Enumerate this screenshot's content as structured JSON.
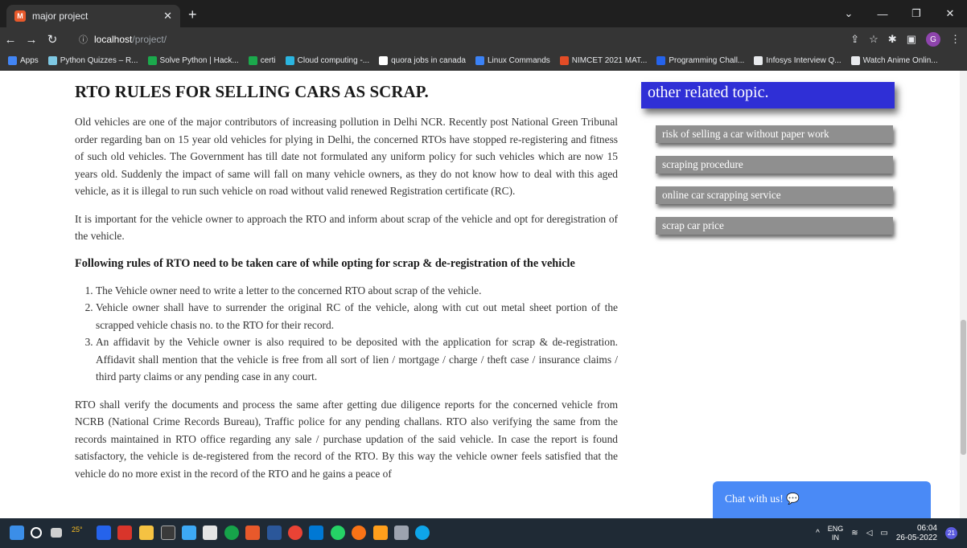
{
  "browser": {
    "tab_title": "major project",
    "tab_favicon": "M",
    "url_host": "localhost",
    "url_path": "/project/",
    "profile_initial": "G",
    "bookmarks": [
      {
        "label": "Apps",
        "color": "#4285f4"
      },
      {
        "label": "Python Quizzes – R...",
        "color": "#7ec8e3"
      },
      {
        "label": "Solve Python | Hack...",
        "color": "#1ba94c"
      },
      {
        "label": "certi",
        "color": "#1ba94c"
      },
      {
        "label": "Cloud computing -...",
        "color": "#2bb5e0"
      },
      {
        "label": "quora jobs in canada",
        "color": "#ffffff"
      },
      {
        "label": "Linux Commands",
        "color": "#3b82f6"
      },
      {
        "label": "NIMCET 2021 MAT...",
        "color": "#e34c26"
      },
      {
        "label": "Programming Chall...",
        "color": "#2563eb"
      },
      {
        "label": "Infosys Interview Q...",
        "color": "#e8eaed"
      },
      {
        "label": "Watch Anime Onlin...",
        "color": "#e8eaed"
      }
    ]
  },
  "article": {
    "title": "RTO RULES FOR SELLING CARS AS SCRAP.",
    "para1": "Old vehicles are one of the major contributors of increasing pollution in Delhi NCR. Recently post National Green Tribunal order regarding ban on 15 year old vehicles for plying in Delhi, the concerned RTOs have stopped re-registering and fitness of such old vehicles. The Government has till date not formulated any uniform policy for such vehicles which are now 15 years old. Suddenly the impact of same will fall on many vehicle owners, as they do not know how to deal with this aged vehicle, as it is illegal to run such vehicle on road without valid renewed Registration certificate (RC).",
    "para2": "It is important for the vehicle owner to approach the RTO and inform about scrap of the vehicle and opt for deregistration of the vehicle.",
    "subheading": "Following rules of RTO need to be taken care of while opting for scrap & de-registration of the vehicle",
    "rules": [
      "The Vehicle owner need to write a letter to the concerned RTO about scrap of the vehicle.",
      "Vehicle owner shall have to surrender the original RC of the vehicle, along with cut out metal sheet portion of the scrapped vehicle chasis no. to the RTO for their record.",
      "An affidavit by the Vehicle owner is also required to be deposited with the application for scrap & de-registration. Affidavit shall mention that the vehicle is free from all sort of lien / mortgage / charge / theft case / insurance claims / third party claims or any pending case in any court."
    ],
    "para3": "RTO shall verify the documents and process the same after getting due diligence reports for the concerned vehicle from NCRB (National Crime Records Bureau), Traffic police for any pending challans. RTO also verifying the same from the records maintained in RTO office regarding any sale / purchase updation of the said vehicle. In case the report is found satisfactory, the vehicle is de-registered from the record of the RTO. By this way the vehicle owner feels satisfied that the vehicle do no more exist in the record of the RTO and he gains a peace of"
  },
  "sidebar": {
    "heading": "other related topic.",
    "topics": [
      "risk of selling a car without paper work",
      "scraping procedure",
      "online car scrapping service",
      "scrap car price"
    ]
  },
  "chat": {
    "label": "Chat with us!"
  },
  "taskbar": {
    "weather_temp": "25°",
    "lang_top": "ENG",
    "lang_bottom": "IN",
    "time": "06:04",
    "date": "26-05-2022",
    "notification_count": "21"
  }
}
